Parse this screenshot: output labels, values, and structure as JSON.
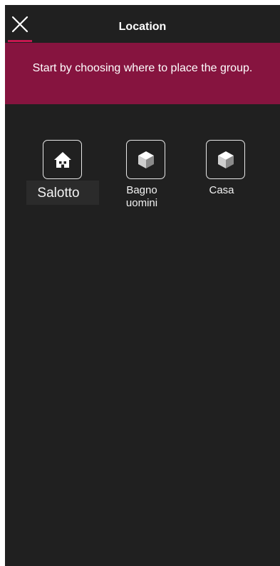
{
  "header": {
    "title": "Location",
    "close_icon": "close-icon"
  },
  "banner": {
    "text": "Start by choosing where to place the group."
  },
  "locations": [
    {
      "label": "Salotto",
      "icon": "house-icon",
      "selected": true
    },
    {
      "label": "Bagno uomini",
      "icon": "cube-icon",
      "selected": false
    },
    {
      "label": "Casa",
      "icon": "cube-icon",
      "selected": false
    }
  ],
  "colors": {
    "background": "#202020",
    "banner": "#86143f",
    "accent": "#c5174f",
    "text": "#ffffff"
  }
}
